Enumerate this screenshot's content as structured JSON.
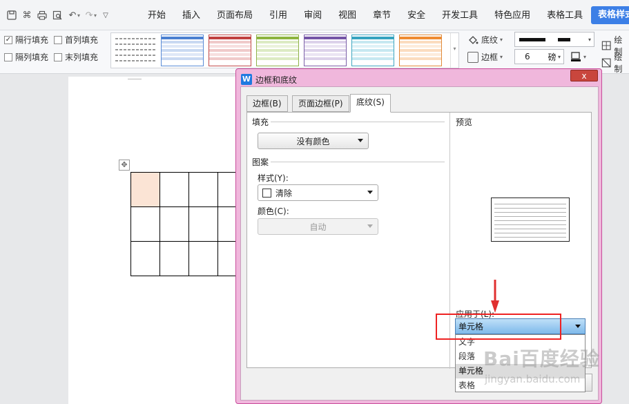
{
  "menubar": {
    "tabs": [
      "开始",
      "插入",
      "页面布局",
      "引用",
      "审阅",
      "视图",
      "章节",
      "安全",
      "开发工具",
      "特色应用",
      "表格工具",
      "表格样式"
    ]
  },
  "ribbon": {
    "checkboxes": [
      {
        "label": "隔行填充",
        "checked": true
      },
      {
        "label": "首列填充",
        "checked": false
      },
      {
        "label": "隔列填充",
        "checked": false
      },
      {
        "label": "末列填充",
        "checked": false
      }
    ],
    "shading_label": "底纹",
    "border_label": "边框",
    "line_size_value": "6",
    "line_unit": "磅",
    "draw_label_1": "绘制",
    "draw_label_2": "绘制"
  },
  "dialog": {
    "title": "边框和底纹",
    "close_label": "x",
    "tabs": [
      "边框(B)",
      "页面边框(P)",
      "底纹(S)"
    ],
    "fill_label": "填充",
    "fill_value": "没有颜色",
    "pattern_label": "图案",
    "style_label": "样式(Y):",
    "style_value": "清除",
    "color_label": "颜色(C):",
    "color_value": "自动",
    "preview_label": "预览",
    "apply_label": "应用于(L):",
    "apply_value": "单元格",
    "apply_options": [
      "文字",
      "段落",
      "单元格",
      "表格"
    ],
    "apply_highlight_index": 2
  },
  "watermark": {
    "brand": "Bai百度经验",
    "url": "jingyan.baidu.com"
  },
  "colors": {
    "accent": "#3c7fe6",
    "dialog_frame": "#f0b7dc",
    "highlight_red": "#ee2222",
    "cell_fill": "#fbe4d5"
  }
}
